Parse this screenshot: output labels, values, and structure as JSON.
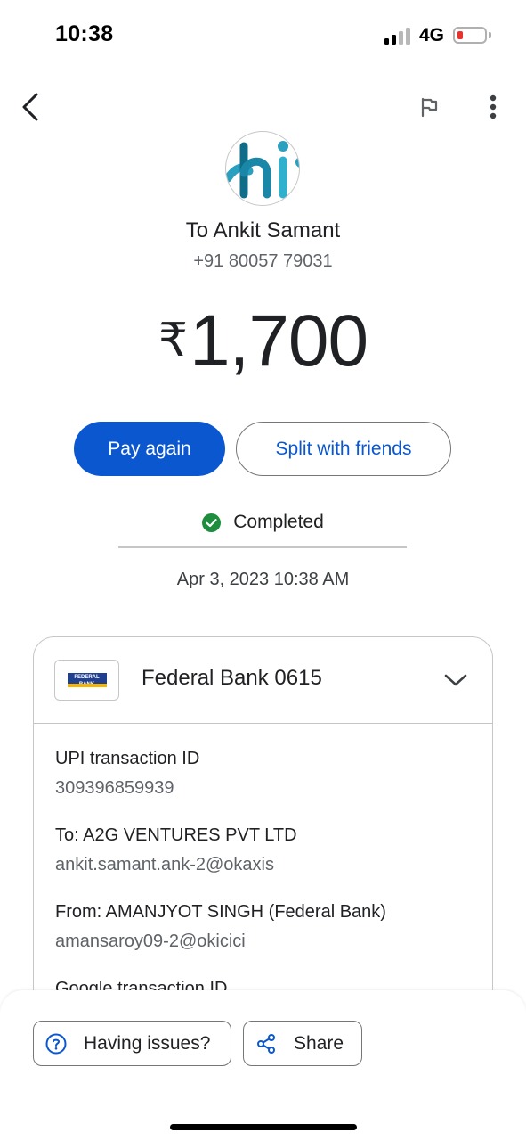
{
  "status_bar": {
    "time": "10:38",
    "network": "4G",
    "battery_level": 0.15
  },
  "nav": {
    "back_icon": "chevron-left-icon",
    "flag_icon": "flag-icon",
    "more_icon": "more-vert-icon"
  },
  "payee": {
    "avatar_text": "hi",
    "name": "To Ankit Samant",
    "phone": "+91 80057 79031"
  },
  "amount": {
    "currency": "₹",
    "value": "1,700"
  },
  "actions": {
    "pay_again": "Pay again",
    "split": "Split with friends"
  },
  "status": {
    "label": "Completed",
    "date": "Apr 3, 2023 10:38 AM"
  },
  "card": {
    "bank_logo_text": "FEDERAL BANK",
    "bank": "Federal Bank 0615",
    "details": [
      {
        "label": "UPI transaction ID",
        "value": "309396859939"
      },
      {
        "label": "To: A2G VENTURES PVT LTD",
        "value": "ankit.samant.ank-2@okaxis"
      },
      {
        "label": "From: AMANJYOT SINGH (Federal Bank)",
        "value": "amansaroy09-2@okicici"
      },
      {
        "label": "Google transaction ID",
        "value": ""
      }
    ]
  },
  "bottom": {
    "issues": "Having issues?",
    "share": "Share"
  },
  "colors": {
    "accent": "#0b57d0",
    "success": "#1e8e3e",
    "battery_low": "#e8322e"
  }
}
